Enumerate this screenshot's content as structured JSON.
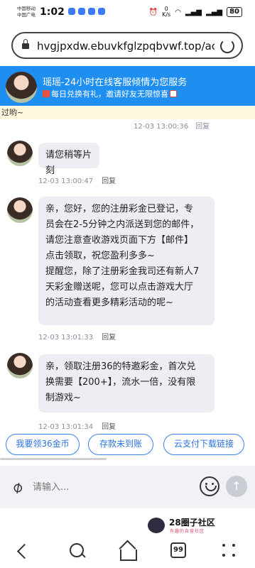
{
  "status_bar": {
    "carrier_1": "中国移动",
    "carrier_2": "中国广电",
    "time": "1:02",
    "net_speed_value": "0",
    "net_speed_unit": "K/s",
    "battery": "80"
  },
  "browser": {
    "url": "hvgjpxdw.ebuvkfglzpqbvwf.top/ac"
  },
  "chat_header": {
    "title": "瑶瑶-24小时在线客服倾情为您服务",
    "subtitle": "每日兑换有礼，邀请好友无限惊喜"
  },
  "notice": "过哟~",
  "previous_meta": {
    "time": "12-03 13:00:36",
    "reply": "回复"
  },
  "messages": [
    {
      "lines": [
        "请您稍等片刻"
      ],
      "time": "12-03 13:00:47",
      "reply": "回复"
    },
    {
      "lines": [
        "亲，您好，您的注册彩金已登记，专",
        "员会在2-5分钟之内派送到您的邮件，",
        "请您注意查收游戏页面下方【邮件】",
        "点击领取，祝您盈利多多~",
        "提醒您，除了注册彩金我司还有新人7",
        "天彩金赠送呢，您可以点击游戏大厅",
        "的活动查看更多精彩活动的呢~"
      ],
      "time": "12-03 13:01:33",
      "reply": "回复"
    },
    {
      "lines": [
        "亲，领取注册36的特邀彩金，首次兑",
        "换需要【200+】，流水一倍，没有限",
        "制游戏~"
      ],
      "time": "12-03 13:01:34",
      "reply": "回复"
    }
  ],
  "quick_replies": [
    "我要领36金币",
    "存款未到账",
    "云支付下载链接"
  ],
  "input": {
    "placeholder": "请输入..."
  },
  "watermark": {
    "title": "28圈子社区",
    "subtitle": "有趣的自营社区"
  },
  "bottom_nav": {
    "tab_count": "99"
  },
  "icons": [
    "lock-icon",
    "reload-icon",
    "gift-icon",
    "dice-icon",
    "attachment-icon",
    "emoji-icon",
    "send-icon",
    "back-icon",
    "search-icon",
    "home-icon",
    "tabs-icon",
    "menu-icon"
  ],
  "colors": {
    "header_blue": "#1f8ef1",
    "notice_bg": "#fcf7dd",
    "bubble_bg": "#eceef3",
    "quick_border": "#3b82e8"
  }
}
